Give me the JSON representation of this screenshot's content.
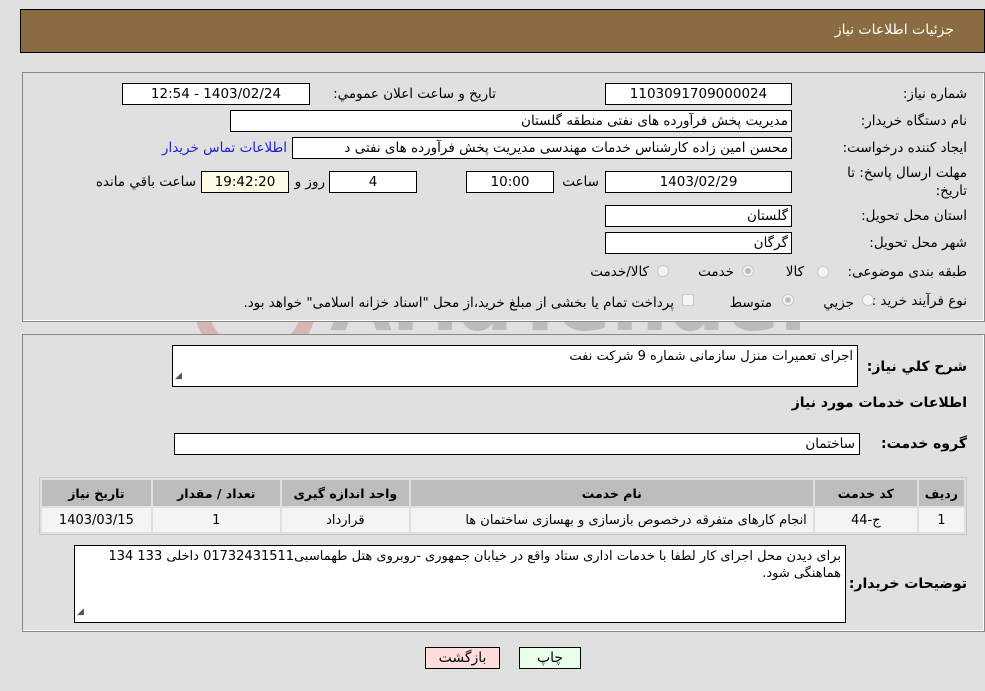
{
  "header": {
    "title": "جزئیات اطلاعات نیاز"
  },
  "details": {
    "need_number_label": "شماره نیاز:",
    "need_number": "1103091709000024",
    "announce_label": "تاریخ و ساعت اعلان عمومي:",
    "announce_value": "1403/02/24 - 12:54",
    "buyer_org_label": "نام دستگاه خریدار:",
    "buyer_org": "مدیریت پخش فرآورده های نفتی منطقه گلستان",
    "creator_label": "ایجاد کننده درخواست:",
    "creator": "محسن امین زاده کارشناس خدمات مهندسی مدیریت پخش فرآورده های نفتی د",
    "contact_link": "اطلاعات تماس خریدار",
    "deadline_label": "مهلت ارسال پاسخ: تا تاریخ:",
    "deadline_date": "1403/02/29",
    "time_label": "ساعت",
    "deadline_time": "10:00",
    "days_value": "4",
    "days_label": "روز و",
    "remaining_time": "19:42:20",
    "remaining_label": "ساعت باقي مانده",
    "province_label": "استان محل تحویل:",
    "province": "گلستان",
    "city_label": "شهر محل تحویل:",
    "city": "گرگان",
    "category_label": "طبقه بندی موضوعی:",
    "category_options": [
      "کالا",
      "خدمت",
      "کالا/خدمت"
    ],
    "category_selected": "خدمت",
    "process_label": "نوع فرآیند خرید :",
    "process_options": [
      "جزيي",
      "متوسط"
    ],
    "process_selected": "متوسط",
    "treasury_note": "پرداخت تمام یا بخشی از مبلغ خرید،از محل \"اسناد خزانه اسلامی\" خواهد بود."
  },
  "services": {
    "summary_label": "شرح کلي نیاز:",
    "summary": "اجرای تعمیرات منزل سازمانی شماره 9 شرکت نفت",
    "section_title": "اطلاعات خدمات مورد نیاز",
    "group_label": "گروه خدمت:",
    "group": "ساختمان",
    "table": {
      "headers": [
        "ردیف",
        "کد خدمت",
        "نام خدمت",
        "واحد اندازه گیری",
        "تعداد / مقدار",
        "تاریخ نیاز"
      ],
      "rows": [
        [
          "1",
          "ج-44",
          "انجام کارهای متفرقه درخصوص بازسازی و بهسازی ساختمان ها",
          "قرارداد",
          "1",
          "1403/03/15"
        ]
      ]
    },
    "buyer_notes_label": "توضیحات خریدار:",
    "buyer_notes": "برای دیدن محل اجرای کار لطفا با خدمات اداری ستاد واقع در خیابان جمهوری -روبروی هتل طهماسبی01732431511  داخلی 133   134  هماهنگی شود."
  },
  "buttons": {
    "print": "چاپ",
    "back": "بازگشت"
  },
  "watermark": {
    "text": "AriaTender.neT"
  },
  "colors": {
    "header_bg": "#8b6c42",
    "print_bg": "#eaffea",
    "back_bg": "#ffdddd",
    "link": "#2020d0"
  }
}
